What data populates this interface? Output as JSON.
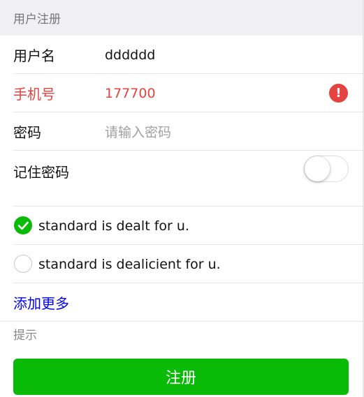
{
  "header": {
    "title": "用户注册"
  },
  "form": {
    "username": {
      "label": "用户名",
      "value": "dddddd"
    },
    "phone": {
      "label": "手机号",
      "value": "177700",
      "error_icon": "!"
    },
    "password": {
      "label": "密码",
      "placeholder": "请输入密码"
    },
    "remember": {
      "label": "记住密码",
      "on": false
    }
  },
  "checklist": {
    "items": [
      {
        "label": "standard is dealt for u.",
        "checked": true
      },
      {
        "label": "standard is dealicient for u.",
        "checked": false
      }
    ],
    "add_more": "添加更多"
  },
  "tips": {
    "text": "提示"
  },
  "submit": {
    "label": "注册"
  },
  "colors": {
    "primary": "#09bb07",
    "warn": "#e64340",
    "link": "#0000ee",
    "header_bg": "#efeff4"
  },
  "icons": {
    "warn": "warn-icon",
    "checked": "checkmark-circle-icon",
    "unchecked": "empty-circle-icon"
  }
}
